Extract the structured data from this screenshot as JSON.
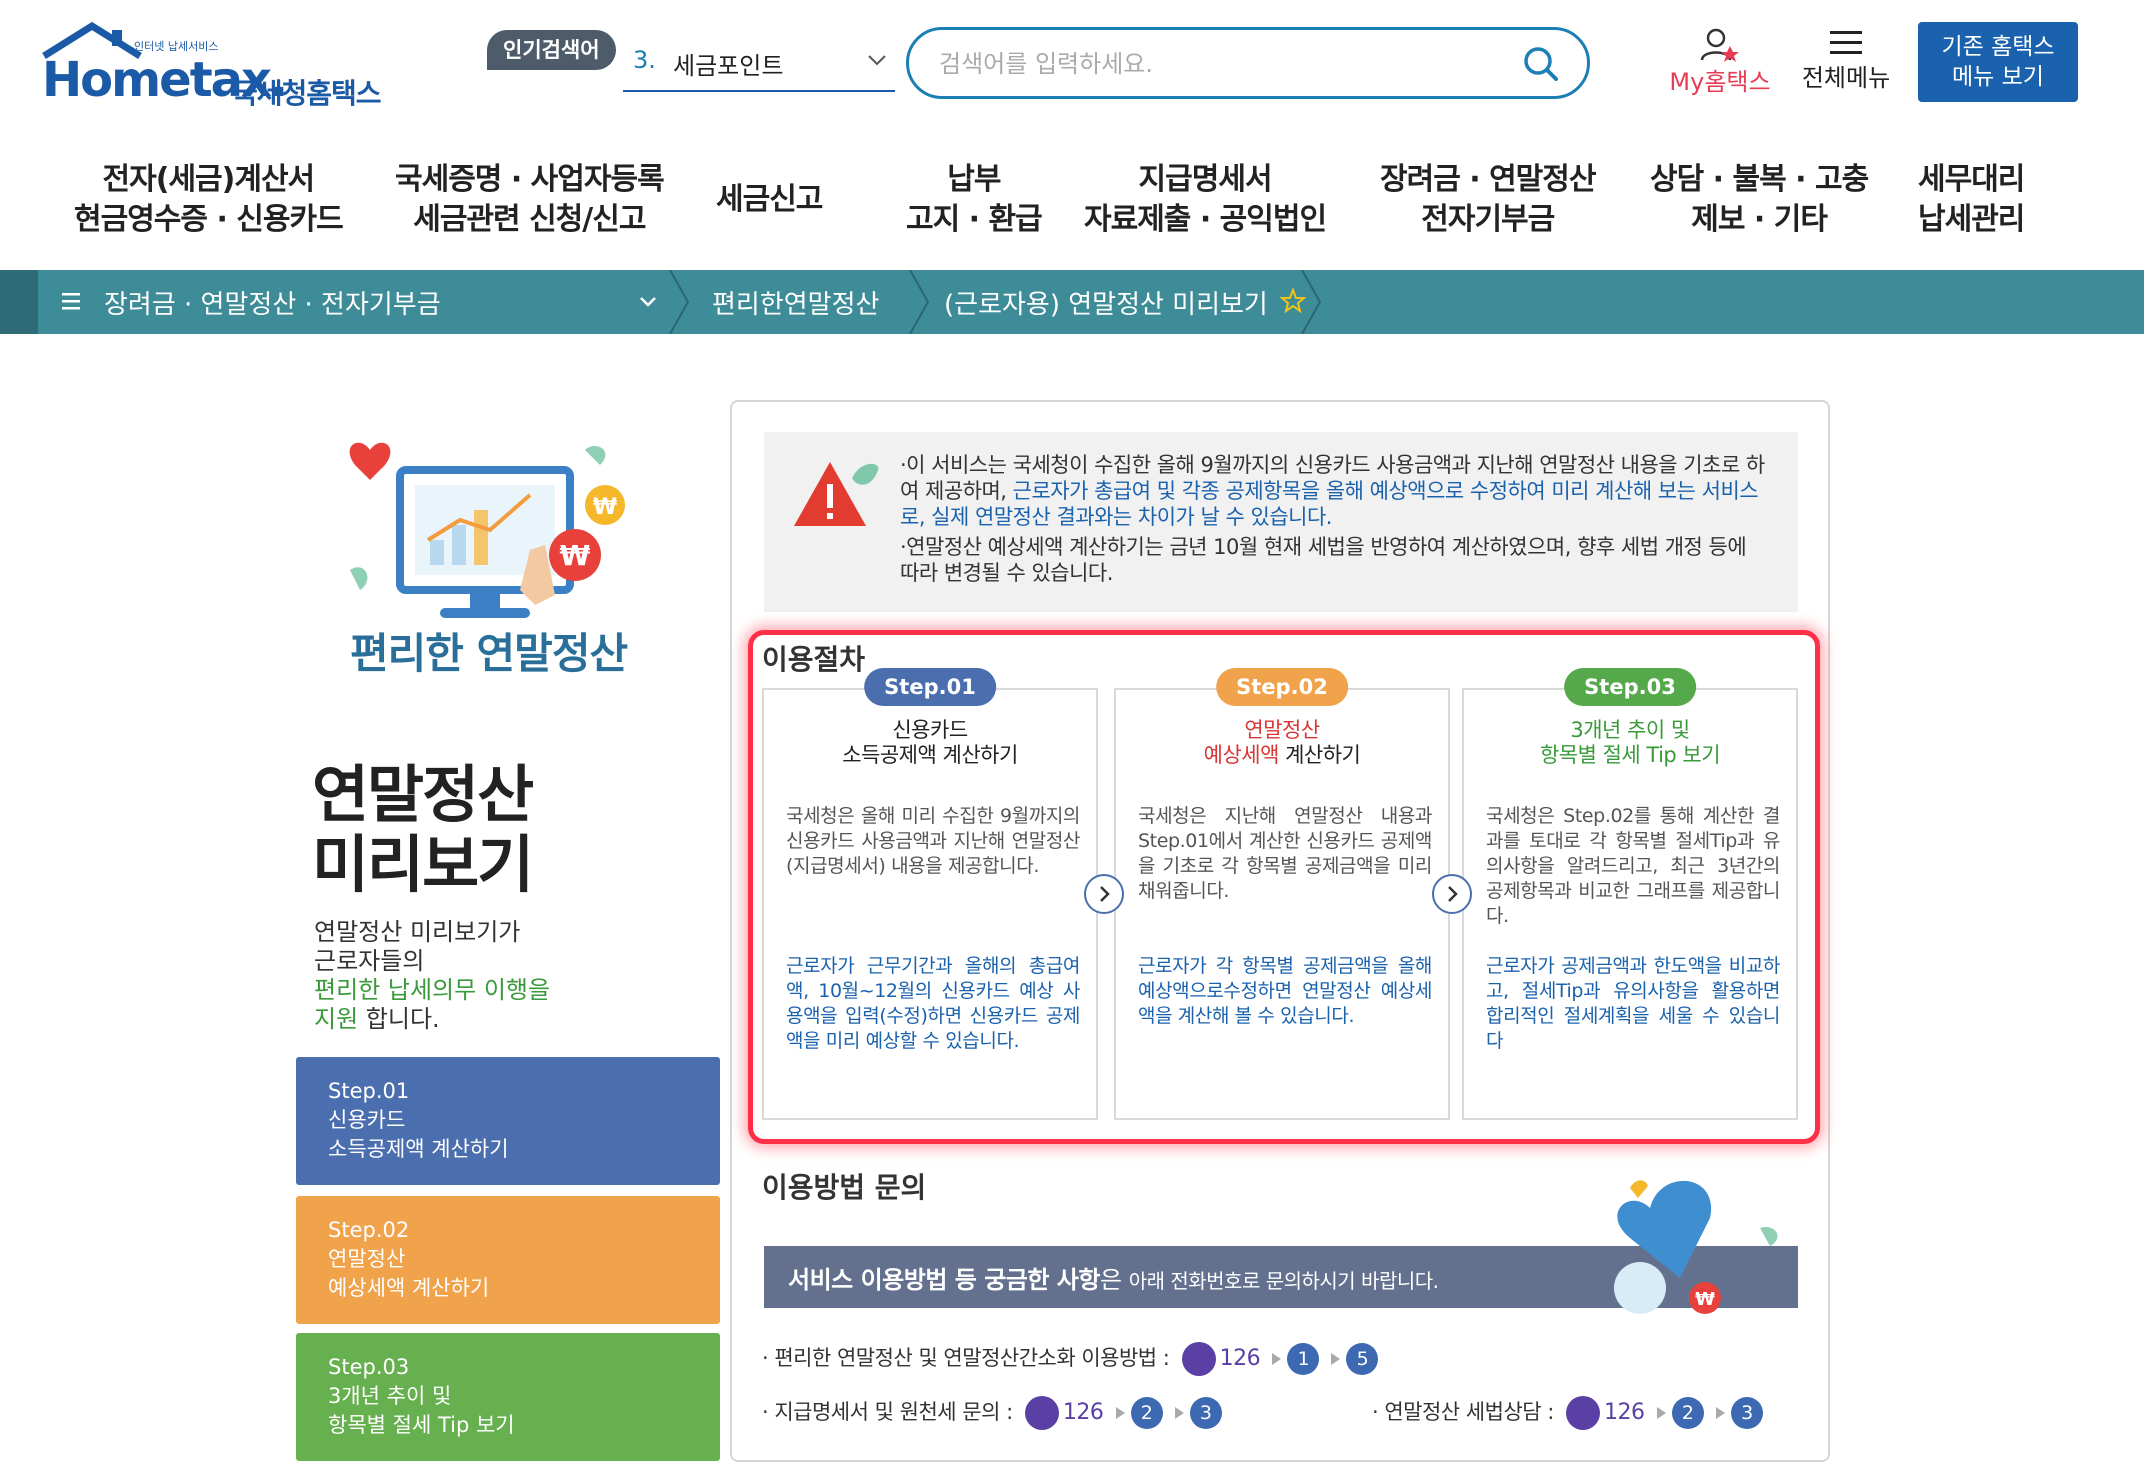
{
  "header": {
    "logo_tagline": "인터넷 납세서비스",
    "logo_main": "Hometax.",
    "logo_sub": "국세청홈택스",
    "hot_badge": "인기검색어",
    "hot_rank": "3.",
    "hot_term": "세금포인트",
    "search_placeholder": "검색어를 입력하세요.",
    "my_label": "My홈택스",
    "allmenu_label": "전체메뉴",
    "old_menu_line1": "기존 홈택스",
    "old_menu_line2": "메뉴 보기"
  },
  "gnb": [
    {
      "line1": "전자(세금)계산서",
      "line2": "현금영수증 · 신용카드"
    },
    {
      "line1": "국세증명 · 사업자등록",
      "line2": "세금관련 신청/신고"
    },
    {
      "line1": "세금신고",
      "line2": ""
    },
    {
      "line1": "납부",
      "line2": "고지 · 환급"
    },
    {
      "line1": "지급명세서",
      "line2": "자료제출 · 공익법인"
    },
    {
      "line1": "장려금 · 연말정산",
      "line2": "전자기부금"
    },
    {
      "line1": "상담 · 불복 · 고충",
      "line2": "제보 · 기타"
    },
    {
      "line1": "세무대리",
      "line2": "납세관리"
    }
  ],
  "breadcrumb": {
    "level1": "장려금 · 연말정산 · 전자기부금",
    "level2": "편리한연말정산",
    "level3": "(근로자용) 연말정산 미리보기"
  },
  "left": {
    "hero_title": "편리한 연말정산",
    "title_line1": "연말정산",
    "title_line2": "미리보기",
    "desc_line1": "연말정산 미리보기가",
    "desc_line2": "근로자들의",
    "desc_green1": "편리한 납세의무 이행을",
    "desc_green2": "지원",
    "desc_end": " 합니다.",
    "steps": [
      {
        "line1": "Step.01",
        "line2": "신용카드",
        "line3": "소득공제액 계산하기"
      },
      {
        "line1": "Step.02",
        "line2": "연말정산",
        "line3": "예상세액 계산하기"
      },
      {
        "line1": "Step.03",
        "line2": "3개년 추이 및",
        "line3": "항목별 절세 Tip 보기"
      }
    ]
  },
  "notice": {
    "p1_a": "·이 서비스는 국세청이 수집한 올해 9월까지의 신용카드 사용금액과 지난해 연말정산 내용을 기초로 하여 제공하며, ",
    "p1_blue": "근로자가 총급여 및 각종 공제항목을 올해 예상액으로 수정하여 미리 계산해 보는 서비스로, 실제 연말정산 결과와는 차이가 날 수 있습니다.",
    "p2": "·연말정산 예상세액 계산하기는 금년 10월 현재 세법을 반영하여 계산하였으며, 향후 세법 개정 등에 따라 변경될 수 있습니다."
  },
  "procedure": {
    "title": "이용절차",
    "cards": [
      {
        "badge": "Step.01",
        "head1": "신용카드",
        "head2": "소득공제액 계산하기",
        "body": "국세청은 올해 미리 수집한 9월까지의 신용카드 사용금액과 지난해 연말정산(지급명세서) 내용을 제공합니다.",
        "foot": "근로자가 근무기간과 올해의 총급여액, 10월~12월의 신용카드 예상 사용액을 입력(수정)하면 신용카드 공제액을 미리 예상할 수 있습니다."
      },
      {
        "badge": "Step.02",
        "head1": "연말정산",
        "head2_red": "예상세액",
        "head2_rest": " 계산하기",
        "body": "국세청은 지난해 연말정산 내용과 Step.01에서 계산한 신용카드 공제액을 기초로 각 항목별 공제금액을 미리 채워줍니다.",
        "foot": "근로자가 각 항목별 공제금액을 올해예상액으로수정하면 연말정산 예상세액을 계산해 볼 수 있습니다."
      },
      {
        "badge": "Step.03",
        "head1": "3개년 추이 및",
        "head2": "항목별 절세 Tip 보기",
        "body": "국세청은 Step.02를 통해 계산한 결과를 토대로 각 항목별 절세Tip과 유의사항을 알려드리고, 최근 3년간의 공제항목과 비교한 그래프를 제공합니다.",
        "foot": "근로자가 공제금액과 한도액을 비교하고, 절세Tip과 유의사항을 활용하면 합리적인 절세계획을 세울 수 있습니다"
      }
    ]
  },
  "inquiry": {
    "title": "이용방법 문의",
    "banner_bold": "서비스 이용방법 등 궁금한 사항",
    "banner_mid": "은 ",
    "banner_small": "아래 전화번호로 문의하시기 바랍니다.",
    "rows": [
      {
        "label": "· 편리한 연말정산 및 연말정산간소화 이용방법 :",
        "num": "126",
        "codes": [
          "1",
          "5"
        ]
      },
      {
        "label": "· 지급명세서 및 원천세 문의 :",
        "num": "126",
        "codes": [
          "2",
          "3"
        ]
      },
      {
        "label": "· 연말정산 세법상담 :",
        "num": "126",
        "codes": [
          "2",
          "3"
        ]
      }
    ]
  },
  "colors": {
    "brand_blue": "#1b5aa6",
    "teal_bar": "#3f8c99",
    "step1": "#4b6fae",
    "step2": "#f0a34b",
    "step3": "#67b04f",
    "highlight_red": "#ff2f48"
  }
}
